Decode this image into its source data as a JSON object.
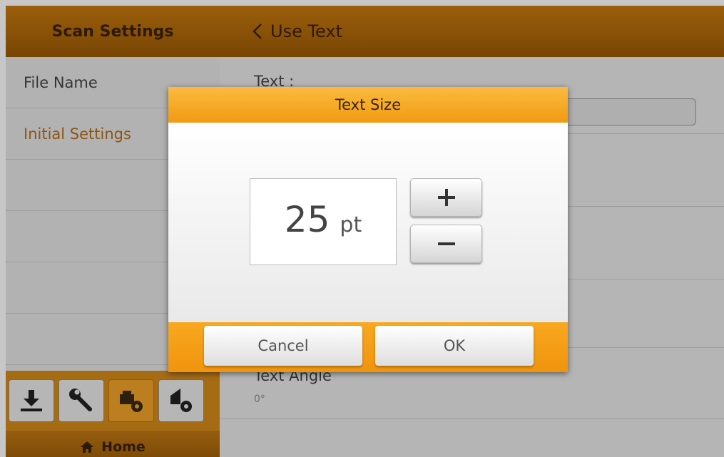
{
  "sidebar": {
    "title": "Scan Settings",
    "items": [
      "File Name",
      "Initial Settings",
      "",
      "",
      "",
      ""
    ],
    "active_index": 1,
    "home_label": "Home",
    "tools": [
      "download-icon",
      "wrench-icon",
      "scanner-settings-icon",
      "upload-settings-icon"
    ]
  },
  "main": {
    "back_label": "Use Text",
    "rows": [
      {
        "label": "Text :",
        "value": ""
      },
      {
        "label": "Text Angle",
        "value": "0°"
      }
    ]
  },
  "dialog": {
    "title": "Text Size",
    "value": "25",
    "unit": "pt",
    "increase_label": "+",
    "decrease_label": "−",
    "cancel_label": "Cancel",
    "ok_label": "OK"
  },
  "colors": {
    "accent": "#f09a12",
    "header_brown": "#9a5a05",
    "active_text": "#b46f1a"
  }
}
